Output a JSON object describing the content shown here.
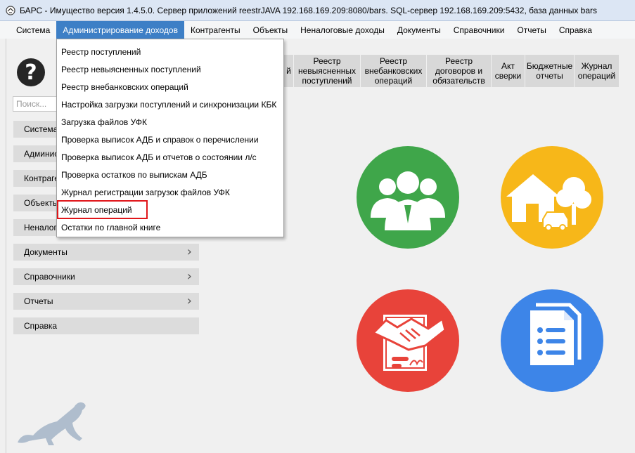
{
  "window": {
    "title": "БАРС - Имущество версия 1.4.5.0. Сервер приложений reestrJAVA 192.168.169.209:8080/bars. SQL-сервер 192.168.169.209:5432, база данных bars"
  },
  "menubar": {
    "items": [
      "Система",
      "Администрирование доходов",
      "Контрагенты",
      "Объекты",
      "Неналоговые доходы",
      "Документы",
      "Справочники",
      "Отчеты",
      "Справка"
    ]
  },
  "search": {
    "placeholder": "Поиск..."
  },
  "help": {
    "glyph": "?"
  },
  "nav": {
    "items": [
      {
        "label": "Система",
        "has_arrow": false
      },
      {
        "label": "Админис",
        "has_arrow": false
      },
      {
        "label": "Контраге",
        "has_arrow": false
      },
      {
        "label": "Объекть",
        "has_arrow": false
      },
      {
        "label": "Неналог",
        "has_arrow": false
      },
      {
        "label": "Документы",
        "has_arrow": true
      },
      {
        "label": "Справочники",
        "has_arrow": true
      },
      {
        "label": "Отчеты",
        "has_arrow": true
      },
      {
        "label": "Справка",
        "has_arrow": false
      }
    ]
  },
  "toolbar": {
    "tiles": [
      {
        "label": "й"
      },
      {
        "label": "Реестр невыясненных поступлений"
      },
      {
        "label": "Реестр внебанковских операций"
      },
      {
        "label": "Реестр договоров и обязательств"
      },
      {
        "label": "Акт сверки"
      },
      {
        "label": "Бюджетные отчеты"
      },
      {
        "label": "Журнал операций"
      }
    ]
  },
  "dropdown": {
    "items": [
      "Реестр поступлений",
      "Реестр невыясненных поступлений",
      "Реестр внебанковских операций",
      "Настройка загрузки поступлений и синхронизации КБК",
      "Загрузка файлов УФК",
      "Проверка выписок АДБ и справок о перечислении",
      "Проверка выписок АДБ и отчетов о состоянии л/с",
      "Проверка остатков по выпискам АДБ",
      "Журнал регистрации загрузок файлов УФК",
      "Журнал операций",
      "Остатки по главной книге"
    ],
    "highlighted_index": 9
  },
  "colors": {
    "accent": "#3d7fc6",
    "green": "#3fa64a",
    "yellow": "#f7b719",
    "red": "#e8433a",
    "blue": "#3d85e8",
    "highlight": "#e0161a"
  },
  "icons": [
    "people-icon",
    "house-property-icon",
    "contract-handshake-icon",
    "document-list-icon",
    "cat-logo"
  ]
}
